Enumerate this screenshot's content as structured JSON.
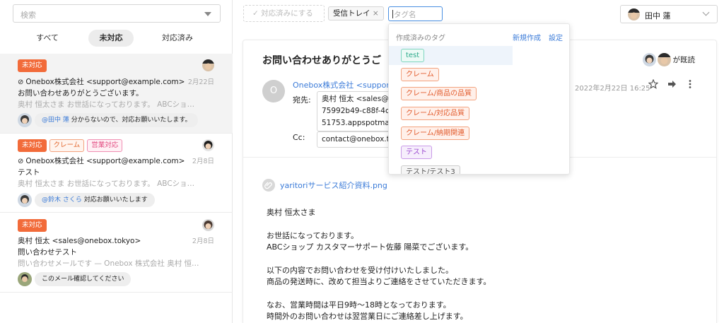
{
  "search": {
    "placeholder": "検索"
  },
  "filters": [
    {
      "label": "すべて"
    },
    {
      "label": "未対応"
    },
    {
      "label": "対応済み"
    }
  ],
  "messages": [
    {
      "badges": [
        "未対応"
      ],
      "date": "2月22日",
      "from": "Onebox株式会社 <support@example.com>",
      "subject": "お問い合わせありがとうございます。",
      "preview": "奥村 恒太さま お世話になっております。 ABCショ…",
      "comment_mention": "@田中 蓮",
      "comment_text": " 分からないので、対応お願いいたします。"
    },
    {
      "badges": [
        "未対応",
        "クレーム",
        "営業対応"
      ],
      "date": "2月8日",
      "from": "Onebox株式会社 <support@example.com>",
      "subject": "テスト",
      "preview": "奥村 恒太さま お世話になっております。 ABCショ…",
      "comment_mention": "@鈴木 さくら",
      "comment_text": " 対応お願いいたします"
    },
    {
      "badges": [
        "未対応"
      ],
      "date": "2月8日",
      "from": "奥村 恒太 <sales@onebox.tokyo>",
      "subject": "問い合わせテスト",
      "preview": "問い合わせメールです — Onebox 株式会社 奥村 恒…",
      "comment_mention": "",
      "comment_text": "このメール確認してください"
    }
  ],
  "toolbar": {
    "mark_done": "対応済みにする",
    "tag_chip": "受信トレイ",
    "tag_chip_remove": "×",
    "tag_input_placeholder": "タグ名",
    "user_name": "田中 蓮"
  },
  "mail": {
    "subject": "お問い合わせありがとうご",
    "read_by": "が既読",
    "sender_initial": "O",
    "from": "Onebox株式会社 <support@",
    "to_label": "宛先:",
    "to_lines": [
      "奥村 恒太 <sales@o",
      "75992b49-c88f-4c",
      "51753.appspotmai"
    ],
    "cc_label": "Cc:",
    "cc": "contact@onebox.to",
    "date": "2022年2月22日 16:25",
    "attachment": "yaritoriサービス紹介資料.png",
    "body": [
      [
        "奥村 恒太さま"
      ],
      [
        "お世話になっております。",
        "ABCショップ カスタマーサポート佐藤 陽菜でございます。"
      ],
      [
        "以下の内容でお問い合わせを受け付けいたしました。",
        "商品の発送時に、改めて担当よりご連絡をさせていただきます。"
      ],
      [
        "なお、営業時間は平日9時〜18時となっております。",
        "時間外のお問い合わせは翌営業日にご連絡差し上げます。"
      ]
    ]
  },
  "tag_dropdown": {
    "header": "作成済みのタグ",
    "new_label": "新規作成",
    "settings_label": "設定",
    "tags": [
      {
        "name": "test",
        "style": "t-test"
      },
      {
        "name": "クレーム",
        "style": "t-red"
      },
      {
        "name": "クレーム/商品の品質",
        "style": "t-red"
      },
      {
        "name": "クレーム/対応品質",
        "style": "t-red"
      },
      {
        "name": "クレーム/納期関連",
        "style": "t-red"
      },
      {
        "name": "テスト",
        "style": "t-purple"
      },
      {
        "name": "テスト/テスト3",
        "style": "t-gray"
      }
    ]
  },
  "colors": {
    "accent": "#3b7bd8",
    "unhandled": "#f26b3a"
  }
}
